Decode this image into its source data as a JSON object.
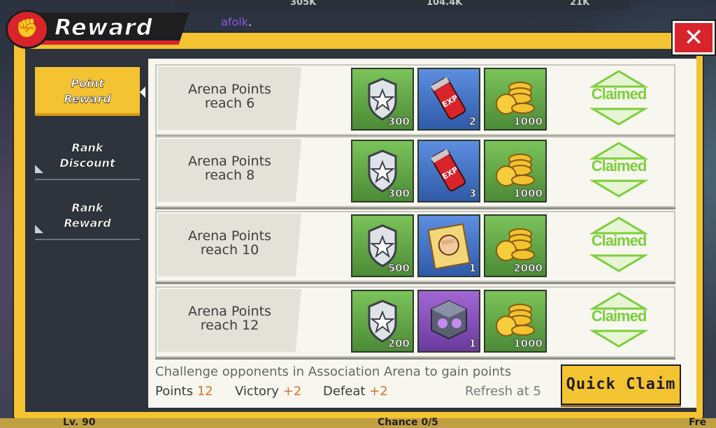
{
  "header": {
    "title": "Reward",
    "username": "afolk",
    "username_suffix": "."
  },
  "background": {
    "top_values": [
      "305K",
      "104.4K",
      "21K"
    ],
    "bottom_left": "Lv. 90",
    "bottom_center": "Chance 0/5",
    "bottom_right": "Fre"
  },
  "tabs": [
    {
      "line1": "Point",
      "line2": "Reward",
      "active": true
    },
    {
      "line1": "Rank",
      "line2": "Discount",
      "active": false
    },
    {
      "line1": "Rank",
      "line2": "Reward",
      "active": false
    }
  ],
  "rows": [
    {
      "goal_line1": "Arena Points",
      "goal_line2": "reach 6",
      "items": [
        {
          "icon": "silver-medal-icon",
          "qty": "300",
          "bg": "green"
        },
        {
          "icon": "exp-can-icon",
          "qty": "2",
          "bg": "blue"
        },
        {
          "icon": "gold-coins-icon",
          "qty": "1000",
          "bg": "green"
        }
      ],
      "status": "Claimed"
    },
    {
      "goal_line1": "Arena Points",
      "goal_line2": "reach 8",
      "items": [
        {
          "icon": "silver-medal-icon",
          "qty": "300",
          "bg": "green"
        },
        {
          "icon": "exp-can-icon",
          "qty": "3",
          "bg": "blue"
        },
        {
          "icon": "gold-coins-icon",
          "qty": "1000",
          "bg": "green"
        }
      ],
      "status": "Claimed"
    },
    {
      "goal_line1": "Arena Points",
      "goal_line2": "reach 10",
      "items": [
        {
          "icon": "silver-medal-icon",
          "qty": "500",
          "bg": "green"
        },
        {
          "icon": "fist-card-icon",
          "qty": "1",
          "bg": "blue"
        },
        {
          "icon": "gold-coins-icon",
          "qty": "2000",
          "bg": "green"
        }
      ],
      "status": "Claimed"
    },
    {
      "goal_line1": "Arena Points",
      "goal_line2": "reach 12",
      "items": [
        {
          "icon": "silver-medal-icon",
          "qty": "200",
          "bg": "green"
        },
        {
          "icon": "mystery-box-icon",
          "qty": "1",
          "bg": "purple"
        },
        {
          "icon": "gold-coins-icon",
          "qty": "1000",
          "bg": "green"
        }
      ],
      "status": "Claimed"
    }
  ],
  "footer": {
    "description": "Challenge opponents in Association Arena to gain points",
    "points_label": "Points",
    "points_value": "12",
    "victory_label": "Victory",
    "victory_value": "+2",
    "defeat_label": "Defeat",
    "defeat_value": "+2",
    "refresh_text": "Refresh at 5",
    "quick_claim": "Quick Claim"
  },
  "colors": {
    "accent": "#f4c332",
    "red": "#d8242a",
    "claimed_green": "#7ccf3a",
    "value_orange": "#d8742a"
  }
}
